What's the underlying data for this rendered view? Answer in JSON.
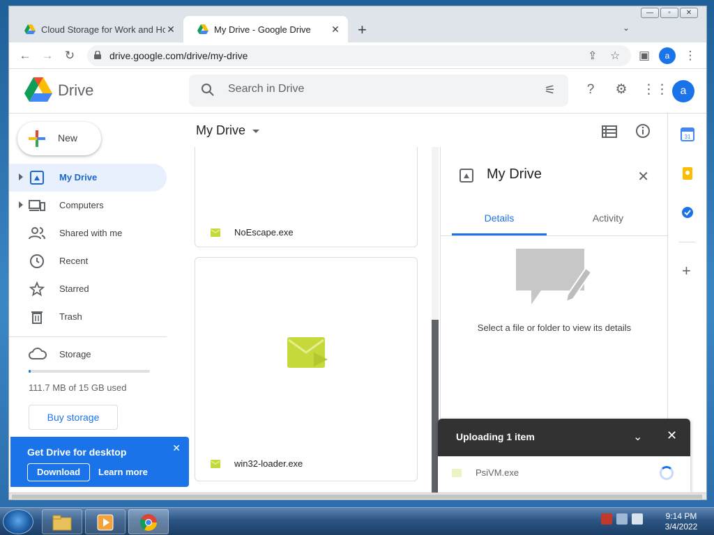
{
  "browser": {
    "tabs": [
      {
        "title": "Cloud Storage for Work and Home - Google Drive",
        "active": false
      },
      {
        "title": "My Drive - Google Drive",
        "active": true
      }
    ],
    "new_tab": "+",
    "url": "drive.google.com/drive/my-drive",
    "profile_initial": "a"
  },
  "drive": {
    "logo_text": "Drive",
    "search_placeholder": "Search in Drive",
    "avatar_initial": "a",
    "new_label": "New",
    "nav": [
      {
        "label": "My Drive",
        "icon": "my-drive-icon",
        "active": true,
        "expandable": true
      },
      {
        "label": "Computers",
        "icon": "computers-icon",
        "active": false,
        "expandable": true
      },
      {
        "label": "Shared with me",
        "icon": "shared-icon",
        "active": false,
        "expandable": false
      },
      {
        "label": "Recent",
        "icon": "clock-icon",
        "active": false,
        "expandable": false
      },
      {
        "label": "Starred",
        "icon": "star-icon",
        "active": false,
        "expandable": false
      },
      {
        "label": "Trash",
        "icon": "trash-icon",
        "active": false,
        "expandable": false
      }
    ],
    "storage": {
      "label": "Storage",
      "used_text": "111.7 MB of 15 GB used",
      "used_fraction": 0.007,
      "buy_label": "Buy storage"
    },
    "desktop_promo": {
      "title": "Get Drive for desktop",
      "download": "Download",
      "learn_more": "Learn more"
    },
    "breadcrumb": "My Drive",
    "files": [
      {
        "name": "NoEscape.exe",
        "icon": "exe-file-icon"
      },
      {
        "name": "win32-loader.exe",
        "icon": "exe-file-icon"
      }
    ],
    "details_panel": {
      "title": "My Drive",
      "tabs": [
        "Details",
        "Activity"
      ],
      "active_tab": "Details",
      "empty_message": "Select a file or folder to view its details"
    },
    "upload": {
      "title": "Uploading 1 item",
      "file": "PsiVM.exe"
    }
  },
  "taskbar": {
    "time": "9:14 PM",
    "date": "3/4/2022"
  },
  "colors": {
    "accent": "#1a73e8",
    "active_nav_bg": "#e8f0fe",
    "upload_header": "#323232",
    "exe_icon": "#c5d93a"
  }
}
